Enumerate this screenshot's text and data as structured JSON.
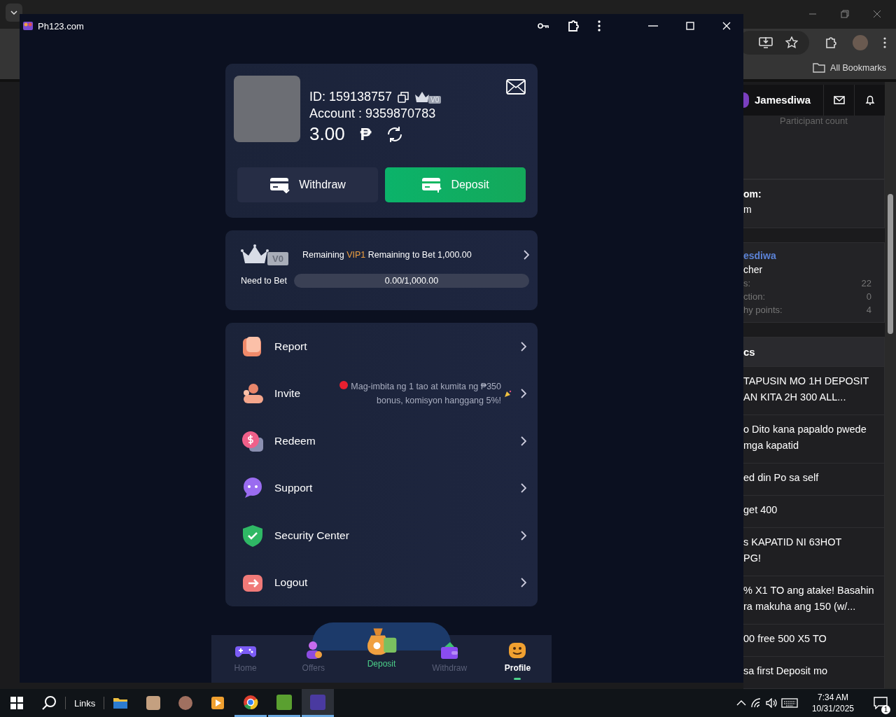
{
  "browser": {
    "bookmarks_label": "All Bookmarks"
  },
  "forum": {
    "user": "Jamesdiwa",
    "participant_label": "Participant count",
    "info_lines": [
      "om:",
      "m"
    ],
    "profile": {
      "name": "esdiwa",
      "role": "cher",
      "stats": [
        {
          "label": "s:",
          "value": "22"
        },
        {
          "label": "ction:",
          "value": "0"
        },
        {
          "label": "hy points:",
          "value": "4"
        }
      ]
    },
    "topics_heading": "cs",
    "topics": [
      "TAPUSIN MO 1H DEPOSIT\nAN KITA 2H 300 ALL...",
      "o Dito kana papaldo pwede\nmga kapatid",
      "ed din Po sa self",
      "get 400",
      "s KAPATID NI 63HOT\nPG!",
      "% X1 TO ang atake! Basahin\nra makuha ang 150 (w/...",
      "00 free 500 X5 TO",
      "sa first Deposit mo"
    ]
  },
  "popup": {
    "title": "Ph123.com"
  },
  "profile": {
    "id": "ID: 159138757",
    "vip": "V0",
    "account": "Account : 9359870783",
    "balance": "3.00",
    "currency": "₱"
  },
  "actions": [
    {
      "kind": "withdraw",
      "label": "Withdraw"
    },
    {
      "kind": "deposit",
      "label": "Deposit"
    }
  ],
  "vip": {
    "badge": "V0",
    "text_before": "Remaining",
    "highlight": "VIP1",
    "text_after": "Remaining to Bet 1,000.00",
    "progress_label": "Need to Bet",
    "progress_text": "0.00/1,000.00",
    "level": 0
  },
  "menu": [
    {
      "kind": "report",
      "label": "Report"
    },
    {
      "kind": "invite",
      "label": "Invite",
      "note": "Mag-imbita ng 1 tao at kumita ng ₱350\nbonus, komisyon hanggang 5%!"
    },
    {
      "kind": "redeem",
      "label": "Redeem"
    },
    {
      "kind": "support",
      "label": "Support"
    },
    {
      "kind": "security",
      "label": "Security Center"
    },
    {
      "kind": "logout",
      "label": "Logout"
    }
  ],
  "nav": [
    {
      "kind": "home",
      "label": "Home",
      "selected": false
    },
    {
      "kind": "offers",
      "label": "Offers",
      "selected": false
    },
    {
      "kind": "deposit",
      "label": "Deposit",
      "selected": false
    },
    {
      "kind": "withdraw",
      "label": "Withdraw",
      "selected": false
    },
    {
      "kind": "profile",
      "label": "Profile",
      "selected": true
    }
  ],
  "taskbar": {
    "links_label": "Links",
    "time": "7:34 AM",
    "date": "10/31/2025",
    "notifications": "1"
  }
}
